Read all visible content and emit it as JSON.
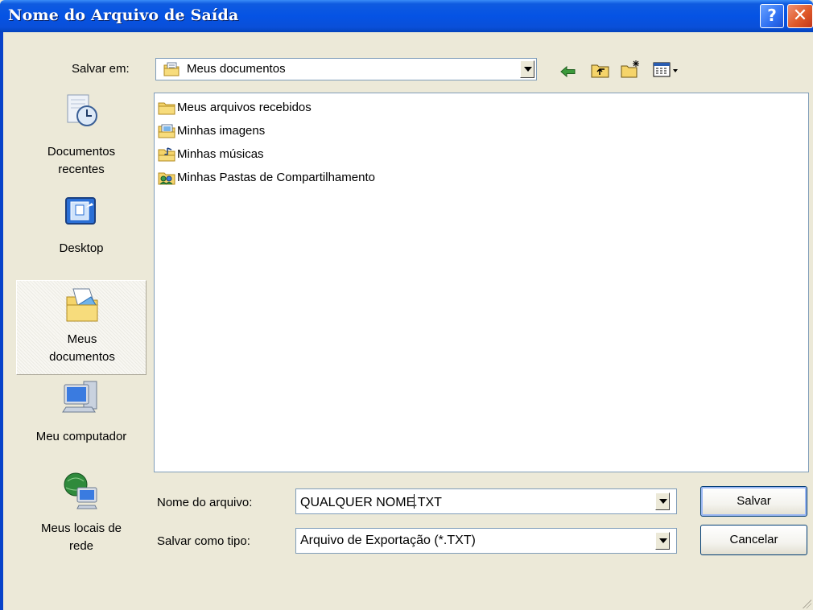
{
  "window": {
    "title": "Nome do Arquivo de Saída",
    "help_symbol": "?",
    "close_symbol": "✕"
  },
  "save_in": {
    "label": "Salvar em:",
    "value": "Meus documentos"
  },
  "toolbar": {
    "icons": [
      "back-arrow-icon",
      "up-one-level-icon",
      "new-folder-icon",
      "view-menu-icon"
    ]
  },
  "places": [
    {
      "icon": "recent-documents-icon",
      "label": "Documentos recentes"
    },
    {
      "icon": "desktop-icon",
      "label": "Desktop"
    },
    {
      "icon": "my-documents-icon",
      "label": "Meus documentos"
    },
    {
      "icon": "my-computer-icon",
      "label": "Meu computador"
    },
    {
      "icon": "network-places-icon",
      "label": "Meus locais de rede"
    }
  ],
  "files": [
    {
      "icon": "folder-icon",
      "name": "Meus arquivos recebidos"
    },
    {
      "icon": "pictures-folder-icon",
      "name": "Minhas imagens"
    },
    {
      "icon": "music-folder-icon",
      "name": "Minhas músicas"
    },
    {
      "icon": "shared-folder-icon",
      "name": "Minhas Pastas de Compartilhamento"
    }
  ],
  "filename": {
    "label": "Nome do arquivo:",
    "value_before_cursor": "QUALQUER NOME",
    "value_after_cursor": ".TXT"
  },
  "filetype": {
    "label": "Salvar como tipo:",
    "value": "Arquivo de Exportação (*.TXT)"
  },
  "buttons": {
    "save": "Salvar",
    "cancel": "Cancelar"
  },
  "colors": {
    "titlebar": "#0553e4",
    "dialog_bg": "#ece9d8",
    "input_border": "#7f9db9",
    "folder_yellow": "#f5d46a"
  }
}
